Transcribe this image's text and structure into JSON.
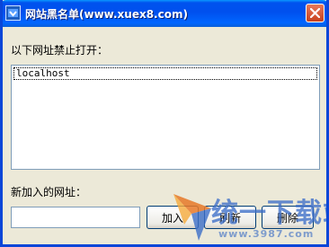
{
  "window": {
    "title": "网站黑名单(www.xuex8.com)",
    "icon": "shield-app-icon",
    "close_icon": "close-icon"
  },
  "blocked": {
    "label": "以下网址禁止打开：",
    "items": [
      "localhost"
    ]
  },
  "add": {
    "label": "新加入的网址：",
    "input_value": "",
    "add_button": "加入",
    "refresh_button": "刷新",
    "delete_button": "删除"
  },
  "watermark": {
    "brand": "统一下载站",
    "url": "www.3987.com"
  },
  "colors": {
    "titlebar": "#0053ee",
    "close": "#c8401c",
    "face": "#ece9d8",
    "watermark": "#3c6ec8"
  }
}
